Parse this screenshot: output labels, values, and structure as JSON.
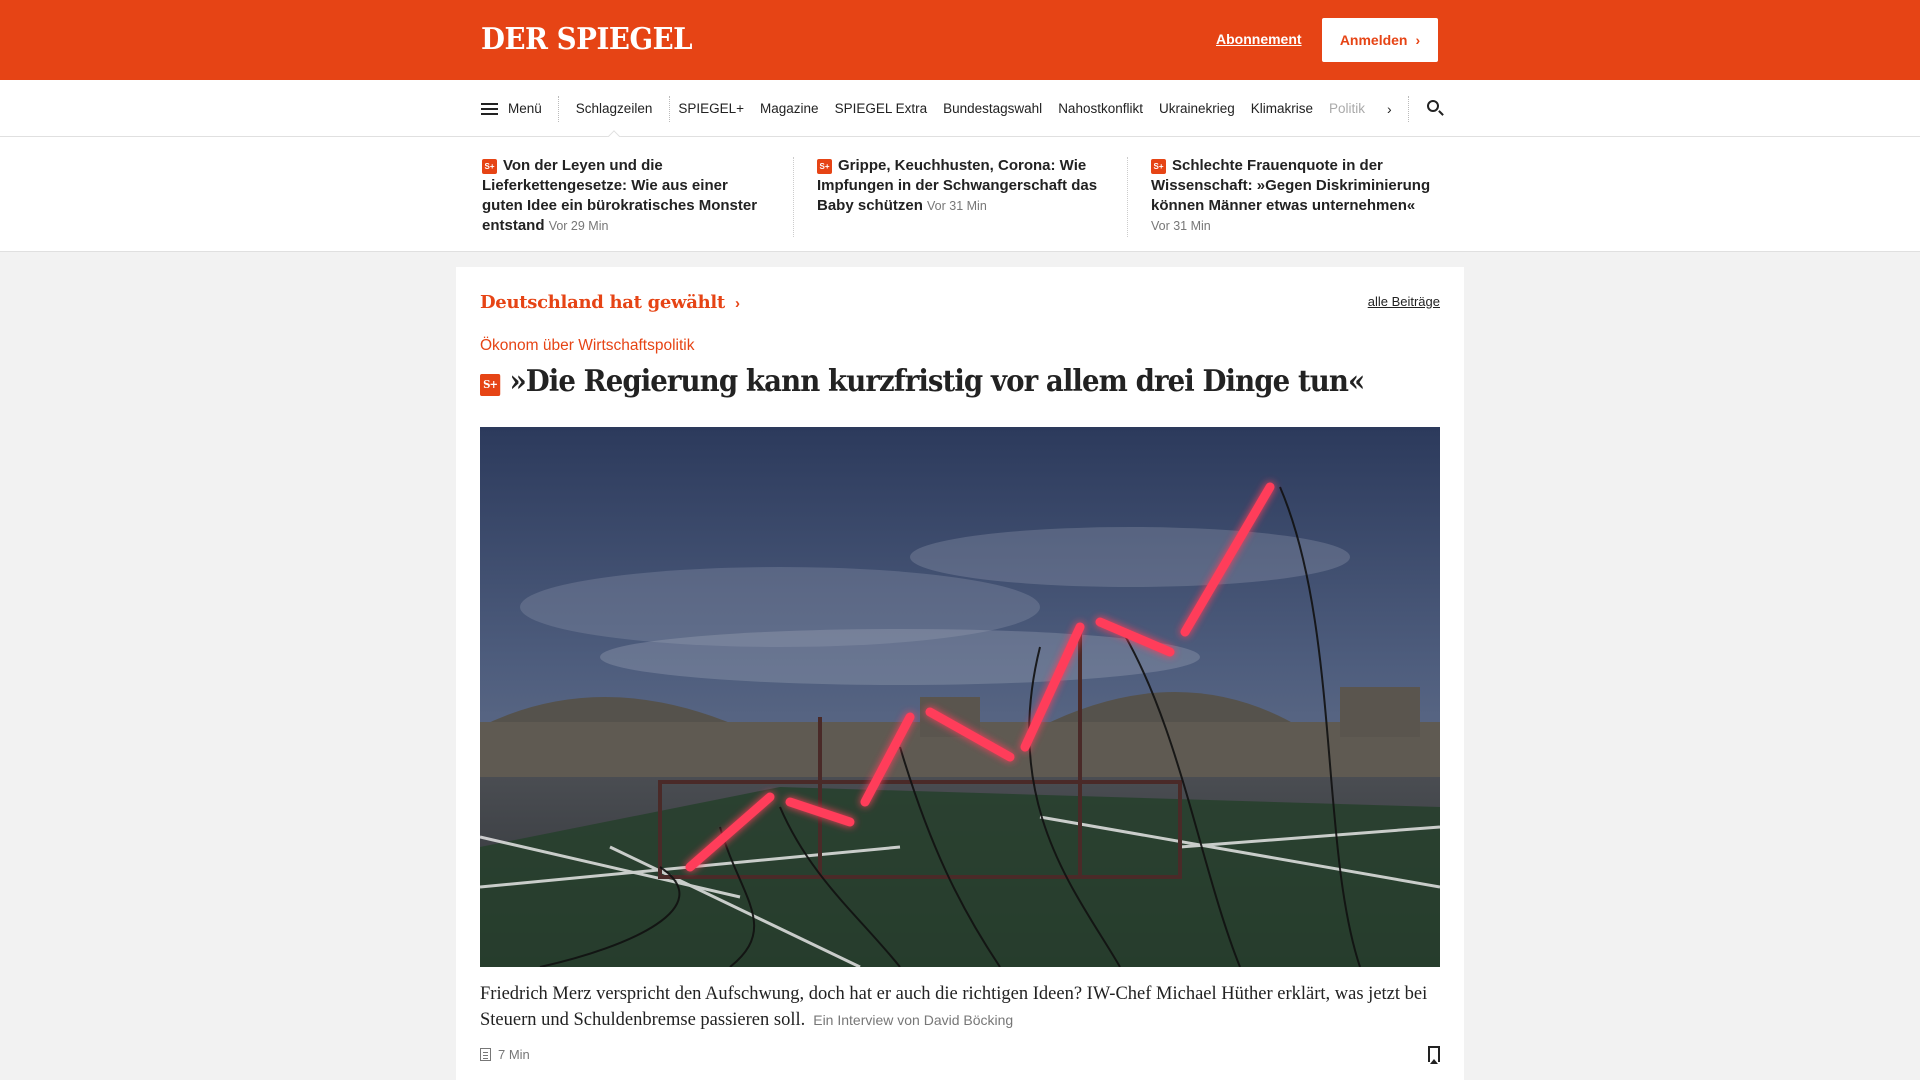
{
  "header": {
    "logo": "DER SPIEGEL",
    "subscription_link": "Abonnement",
    "login_button": "Anmelden",
    "brand_color": "#e64415"
  },
  "nav": {
    "menu_label": "Menü",
    "items": [
      {
        "label": "Schlagzeilen",
        "active": true
      },
      {
        "label": "SPIEGEL+"
      },
      {
        "label": "Magazine"
      },
      {
        "label": "SPIEGEL Extra"
      },
      {
        "label": "Bundestagswahl"
      },
      {
        "label": "Nahostkonflikt"
      },
      {
        "label": "Ukrainekrieg"
      },
      {
        "label": "Klimakrise"
      },
      {
        "label": "Politik"
      }
    ],
    "more_icon": "chevron-right-icon",
    "search_icon": "search-icon"
  },
  "headlines": [
    {
      "badge": "S+",
      "title": "Von der Leyen und die Lieferkettengesetze: Wie aus einer guten Idee ein bürokratisches Monster entstand",
      "time": "Vor 29 Min"
    },
    {
      "badge": "S+",
      "title": "Grippe, Keuchhusten, Corona: Wie Impfungen in der Schwangerschaft das Baby schützen",
      "time": "Vor 31 Min"
    },
    {
      "badge": "S+",
      "title": "Schlechte Frauenquote in der Wissenschaft: »Gegen Diskriminierung können Männer etwas unternehmen«",
      "time": "Vor 31 Min"
    }
  ],
  "main": {
    "section_title": "Deutschland hat gewählt",
    "all_posts_link": "alle Beiträge",
    "kicker": "Ökonom über Wirtschaftspolitik",
    "badge": "S+",
    "headline": "»Die Regierung kann kurzfristig vor allem drei Dinge tun«",
    "teaser": "Friedrich Merz verspricht den Aufschwung, doch hat er auch die richtigen Ideen? IW-Chef Michael Hüther erklärt, was jetzt bei Steuern und Schuldenbremse passieren soll.",
    "author": "Ein Interview von David Böcking",
    "read_time": "7 Min"
  }
}
